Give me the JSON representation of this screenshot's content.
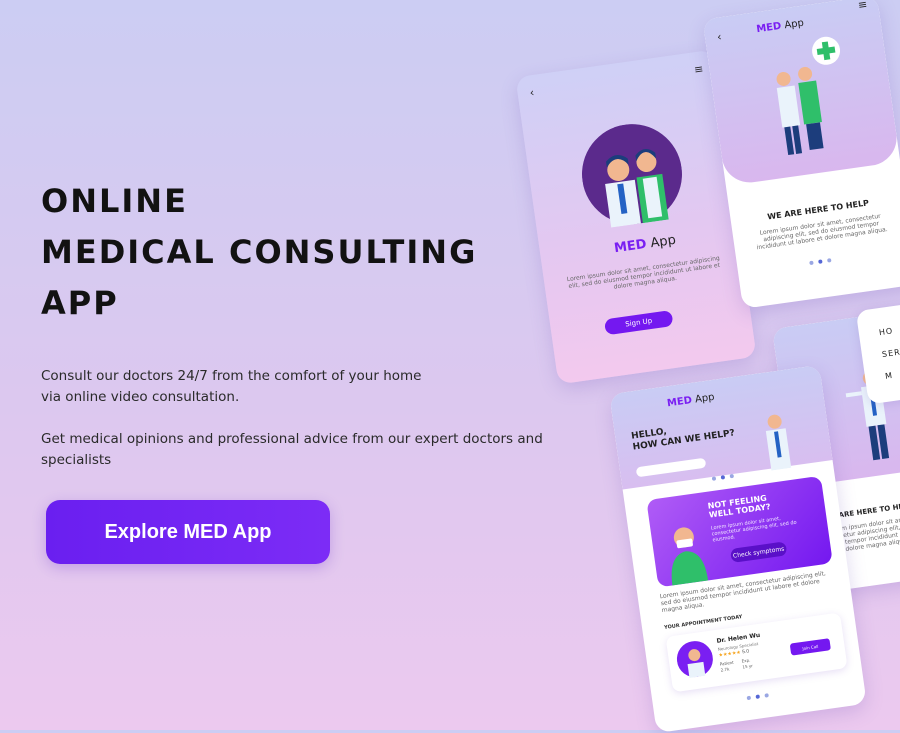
{
  "hero": {
    "title_lines": [
      "ONLINE",
      "MEDICAL CONSULTING",
      "APP"
    ],
    "paragraphs": [
      "Consult our doctors 24/7 from the comfort of your home",
      "via online video consultation.",
      "Get medical opinions and professional advice from our expert doctors and specialists"
    ],
    "cta_label": "Explore MED App"
  },
  "mockups": {
    "brand_strong": "MED",
    "brand_rest": "App",
    "signup_screen": {
      "lorem": "Lorem ipsum dolor sit amet, consectetur adipiscing elit, sed do eiusmod tempor incididunt ut labore et dolore magna aliqua.",
      "signup_button": "Sign Up"
    },
    "help_screen": {
      "heading": "WE ARE HERE TO HELP",
      "lorem": "Lorem ipsum dolor sit amet, consectetur adipiscing elit, sed do eiusmod tempor incididunt ut labore et dolore magna aliqua."
    },
    "home_screen": {
      "greeting_line1": "HELLO,",
      "greeting_line2": "HOW CAN WE HELP?",
      "promo_line1": "NOT FEELING",
      "promo_line2": "WELL TODAY?",
      "promo_lorem": "Lorem ipsum dolor sit amet, consectetur adipiscing elit, sed do eiusmod.",
      "check_button": "Check symptoms",
      "body_lorem": "Lorem ipsum dolor sit amet, consectetur adipiscing elit, sed do eiusmod tempor incididunt ut labore et dolore magna aliqua.",
      "appointment_label": "YOUR APPOINTMENT TODAY",
      "doctor_name": "Dr. Helen Wu",
      "doctor_specialty": "Neurology Specialist",
      "rating": "5.0",
      "patient_label": "Patient",
      "patient_value": "2.7k",
      "exp_label": "Exp.",
      "exp_value": "15 yr",
      "join_button": "Join Call"
    },
    "service_screen": {
      "heading": "WE ARE HERE TO HELP",
      "lorem": "Lorem ipsum dolor sit amet, consectetur adipiscing elit, sed do eiusmod tempor incididunt ut labore et dolore magna aliqua.",
      "partial_lines": [
        "HO",
        "SERV",
        "M"
      ]
    }
  },
  "colors": {
    "accent": "#7418f0",
    "text_dark": "#121212",
    "green": "#2fbf6a"
  },
  "icons": {
    "back": "‹",
    "menu": "≡"
  }
}
